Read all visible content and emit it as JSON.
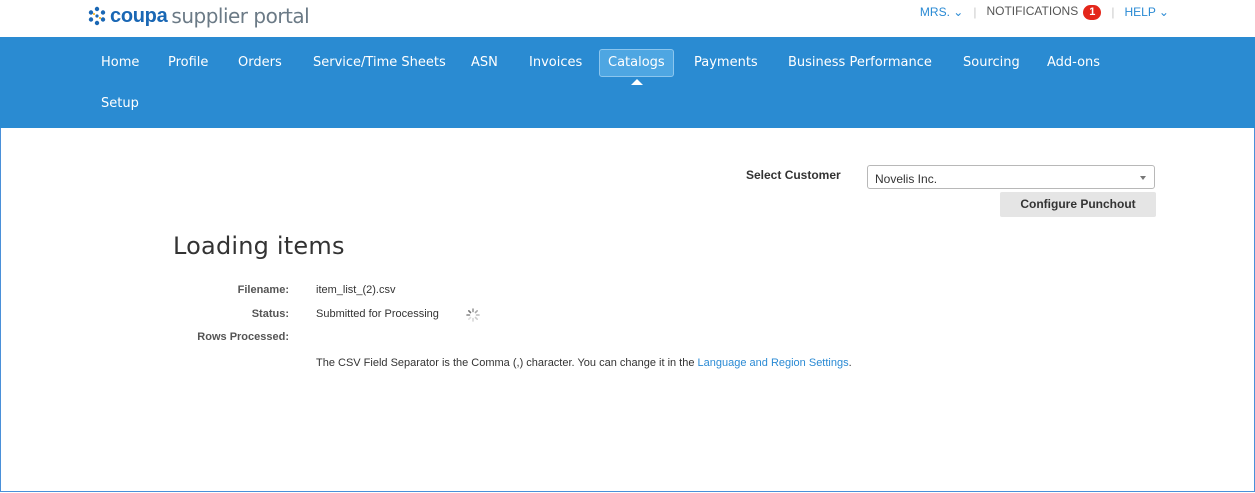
{
  "header": {
    "brand": "coupa",
    "brand_sub": "supplier portal",
    "user_menu": "MRS. ⌄",
    "notifications_label": "NOTIFICATIONS",
    "notifications_count": "1",
    "help_menu": "HELP ⌄"
  },
  "nav": {
    "items": [
      "Home",
      "Profile",
      "Orders",
      "Service/Time Sheets",
      "ASN",
      "Invoices",
      "Catalogs",
      "Payments",
      "Business Performance",
      "Sourcing",
      "Add-ons",
      "Setup"
    ],
    "active": "Catalogs"
  },
  "customer": {
    "label": "Select Customer",
    "selected": "Novelis Inc.",
    "configure_button": "Configure Punchout"
  },
  "page": {
    "title": "Loading items",
    "filename_label": "Filename:",
    "filename": "item_list_(2).csv",
    "status_label": "Status:",
    "status": "Submitted for Processing",
    "rows_label": "Rows Processed:",
    "rows_value": "",
    "note_prefix": "The CSV Field Separator is the Comma (,) character. You can change it in the ",
    "note_link": "Language and Region Settings",
    "note_suffix": "."
  },
  "colors": {
    "nav_bg": "#2a8bd2",
    "accent": "#2a8ad4",
    "badge": "#e4261a"
  }
}
